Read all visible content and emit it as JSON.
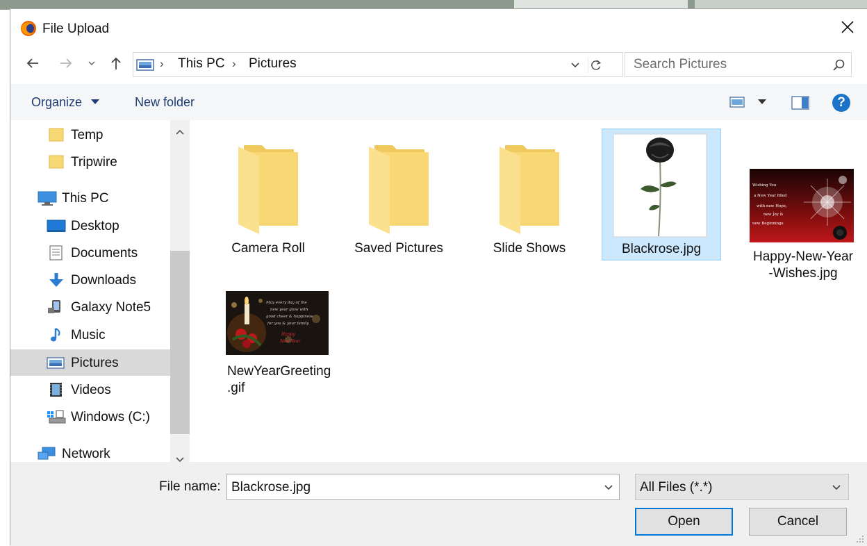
{
  "window": {
    "title": "File Upload"
  },
  "address_bar": {
    "crumbs": [
      "This PC",
      "Pictures"
    ]
  },
  "search": {
    "placeholder": "Search Pictures"
  },
  "toolbar": {
    "organize_label": "Organize",
    "new_folder_label": "New folder",
    "help_label": "?"
  },
  "nav_pane": {
    "items": [
      {
        "label": "Temp",
        "icon": "folder-icon"
      },
      {
        "label": "Tripwire",
        "icon": "folder-icon"
      },
      {
        "label": "This PC",
        "icon": "computer-icon"
      },
      {
        "label": "Desktop",
        "icon": "desktop-icon"
      },
      {
        "label": "Documents",
        "icon": "documents-icon"
      },
      {
        "label": "Downloads",
        "icon": "downloads-icon"
      },
      {
        "label": "Galaxy Note5",
        "icon": "phone-icon"
      },
      {
        "label": "Music",
        "icon": "music-icon"
      },
      {
        "label": "Pictures",
        "icon": "pictures-icon",
        "selected": true
      },
      {
        "label": "Videos",
        "icon": "videos-icon"
      },
      {
        "label": "Windows (C:)",
        "icon": "drive-icon"
      },
      {
        "label": "Network",
        "icon": "network-icon"
      }
    ]
  },
  "files": [
    {
      "name": "Camera Roll",
      "type": "folder"
    },
    {
      "name": "Saved Pictures",
      "type": "folder"
    },
    {
      "name": "Slide Shows",
      "type": "folder"
    },
    {
      "name": "Blackrose.jpg",
      "type": "image",
      "selected": true
    },
    {
      "name_line1": "Happy-New-Year",
      "name_line2": "-Wishes.jpg",
      "type": "image"
    },
    {
      "name_line1": "NewYearGreeting",
      "name_line2": ".gif",
      "type": "image"
    }
  ],
  "thumbnail_text": {
    "wishes": [
      "Wishing You",
      "a New Year filled",
      "with new Hope,",
      "new Joy &",
      "new Beginnings"
    ],
    "greeting": [
      "May every day of the",
      "new year glow with",
      "good cheer & happiness",
      "for you & your family",
      "Happy",
      "New Year"
    ]
  },
  "footer": {
    "file_name_label": "File name:",
    "file_name_value": "Blackrose.jpg",
    "file_type_value": "All Files (*.*)",
    "open_label": "Open",
    "cancel_label": "Cancel"
  },
  "colors": {
    "accent": "#0078d7",
    "selection_bg": "#cce8ff",
    "link_text": "#1e3c73",
    "help_blue": "#1a73c8",
    "folder_yellow": "#f8d775"
  }
}
